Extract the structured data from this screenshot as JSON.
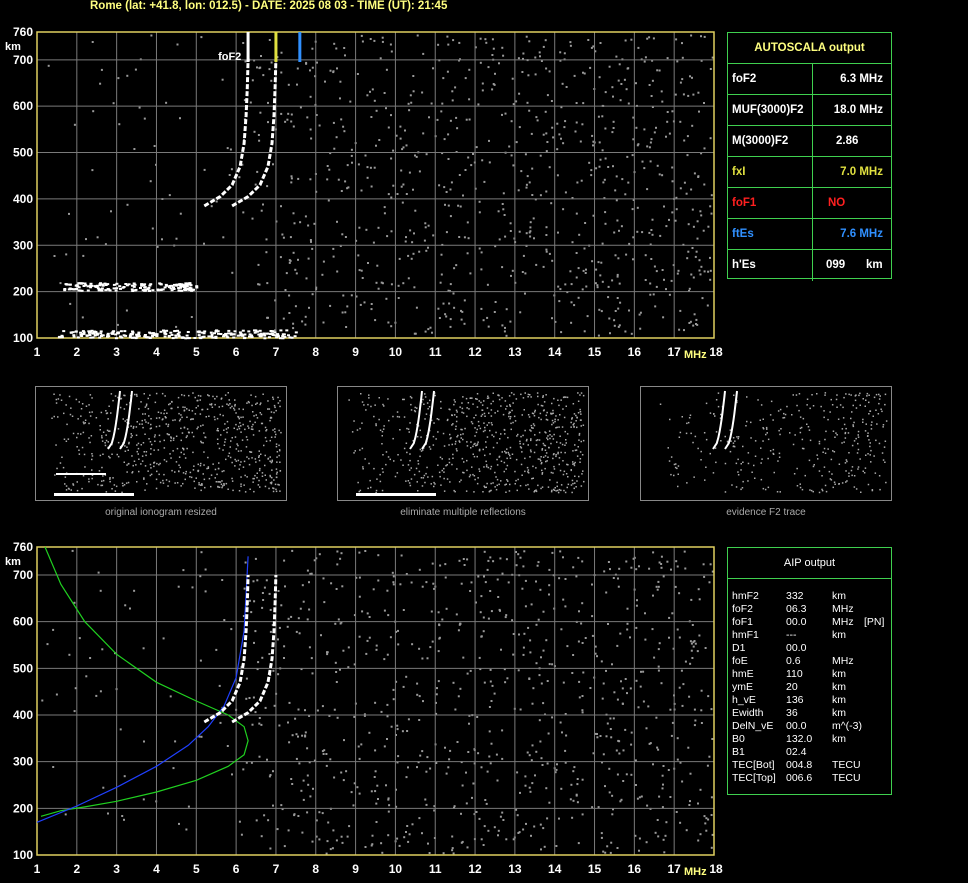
{
  "header": "Rome (lat: +41.8, lon: 012.5) - DATE: 2025 08 03 - TIME (UT): 21:45",
  "autoscala": {
    "title": "AUTOSCALA output",
    "rows": [
      {
        "label": "foF2",
        "value": "6.3 MHz",
        "color": "#ffffff"
      },
      {
        "label": "MUF(3000)F2",
        "value": "18.0 MHz",
        "color": "#ffffff"
      },
      {
        "label": "M(3000)F2",
        "value": "2.86",
        "color": "#ffffff"
      },
      {
        "label": "fxI",
        "value": "7.0 MHz",
        "color": "#e0e040"
      },
      {
        "label": "foF1",
        "value": "NO",
        "color": "#ff2020"
      },
      {
        "label": "ftEs",
        "value": "7.6 MHz",
        "color": "#3090ff"
      },
      {
        "label": "h'Es",
        "value": "099",
        "unit": "km",
        "color": "#ffffff"
      }
    ]
  },
  "aip": {
    "title": "AIP output",
    "rows": [
      {
        "label": "hmF2",
        "value": "332",
        "unit": "km",
        "extra": ""
      },
      {
        "label": "foF2",
        "value": "06.3",
        "unit": "MHz",
        "extra": ""
      },
      {
        "label": "foF1",
        "value": "00.0",
        "unit": "MHz",
        "extra": "[PN]"
      },
      {
        "label": "hmF1",
        "value": "---",
        "unit": "km",
        "extra": ""
      },
      {
        "label": "D1",
        "value": "00.0",
        "unit": "",
        "extra": ""
      },
      {
        "label": "foE",
        "value": "0.6",
        "unit": "MHz",
        "extra": ""
      },
      {
        "label": "hmE",
        "value": "110",
        "unit": "km",
        "extra": ""
      },
      {
        "label": "ymE",
        "value": "20",
        "unit": "km",
        "extra": ""
      },
      {
        "label": "h_vE",
        "value": "136",
        "unit": "km",
        "extra": ""
      },
      {
        "label": "Ewidth",
        "value": "36",
        "unit": "km",
        "extra": ""
      },
      {
        "label": "DelN_vE",
        "value": "00.0",
        "unit": "m^(-3)",
        "extra": ""
      },
      {
        "label": "B0",
        "value": "132.0",
        "unit": "km",
        "extra": ""
      },
      {
        "label": "B1",
        "value": "02.4",
        "unit": "",
        "extra": ""
      },
      {
        "label": "TEC[Bot]",
        "value": "004.8",
        "unit": "TECU",
        "extra": ""
      },
      {
        "label": "TEC[Top]",
        "value": "006.6",
        "unit": "TECU",
        "extra": ""
      }
    ]
  },
  "thumbnails": [
    {
      "label": "original ionogram resized"
    },
    {
      "label": "eliminate multiple reflections"
    },
    {
      "label": "evidence F2 trace"
    }
  ],
  "chart_data": [
    {
      "type": "scatter",
      "xlabel": "MHz",
      "ylabel": "km",
      "xlim": [
        1,
        18
      ],
      "ylim": [
        100,
        760
      ],
      "x_ticks": [
        1,
        2,
        3,
        4,
        5,
        6,
        7,
        8,
        9,
        10,
        11,
        12,
        13,
        14,
        15,
        16,
        17,
        18
      ],
      "y_ticks": [
        100,
        200,
        300,
        400,
        500,
        600,
        700,
        760
      ],
      "markers": [
        {
          "name": "foF2",
          "x": 6.3,
          "color": "#ffffff"
        },
        {
          "name": "fxI",
          "x": 7.0,
          "color": "#e0e040"
        },
        {
          "name": "ftEs",
          "x": 7.6,
          "color": "#3090ff"
        }
      ],
      "series": [
        {
          "name": "o-trace",
          "x": [
            5.2,
            5.6,
            5.9,
            6.1,
            6.2,
            6.25,
            6.28,
            6.3
          ],
          "y": [
            385,
            405,
            430,
            470,
            520,
            580,
            640,
            700
          ]
        },
        {
          "name": "x-trace",
          "x": [
            5.9,
            6.3,
            6.6,
            6.8,
            6.9,
            6.95,
            6.98,
            7.0
          ],
          "y": [
            385,
            405,
            430,
            470,
            520,
            580,
            640,
            700
          ]
        },
        {
          "name": "Es",
          "x": [
            1.5,
            2.5,
            3.5,
            4.5,
            5.5,
            6.5,
            7.5
          ],
          "y": [
            110,
            110,
            110,
            110,
            110,
            110,
            110
          ]
        },
        {
          "name": "Es-multiple",
          "x": [
            1.5,
            2.5,
            3.5,
            4.5,
            5.0
          ],
          "y": [
            212,
            212,
            212,
            212,
            212
          ]
        }
      ]
    },
    {
      "type": "line",
      "xlabel": "MHz",
      "ylabel": "km",
      "xlim": [
        1,
        18
      ],
      "ylim": [
        100,
        760
      ],
      "x_ticks": [
        1,
        2,
        3,
        4,
        5,
        6,
        7,
        8,
        9,
        10,
        11,
        12,
        13,
        14,
        15,
        16,
        17,
        18
      ],
      "y_ticks": [
        100,
        200,
        300,
        400,
        500,
        600,
        700,
        760
      ],
      "series": [
        {
          "name": "profile",
          "color": "#20d020",
          "x": [
            1.1,
            1.6,
            2.2,
            3.0,
            4.0,
            5.0,
            5.8,
            6.2,
            6.3,
            6.2,
            5.8,
            5.0,
            4.0,
            3.0,
            2.2,
            1.6,
            1.2
          ],
          "y": [
            183,
            195,
            203,
            215,
            235,
            260,
            290,
            315,
            345,
            375,
            400,
            430,
            470,
            530,
            600,
            680,
            760
          ]
        },
        {
          "name": "virtual",
          "color": "#2040ff",
          "x": [
            1.0,
            2.0,
            3.0,
            4.0,
            4.8,
            5.3,
            5.7,
            6.0,
            6.2,
            6.3
          ],
          "y": [
            170,
            205,
            245,
            290,
            335,
            375,
            420,
            480,
            580,
            740
          ]
        },
        {
          "name": "o-trace",
          "color": "#ffffff",
          "x": [
            5.2,
            5.6,
            5.9,
            6.1,
            6.2,
            6.25,
            6.28,
            6.3
          ],
          "y": [
            385,
            405,
            430,
            470,
            520,
            580,
            640,
            700
          ]
        },
        {
          "name": "x-trace",
          "color": "#ffffff",
          "x": [
            5.9,
            6.3,
            6.6,
            6.8,
            6.9,
            6.95,
            6.98,
            7.0
          ],
          "y": [
            385,
            405,
            430,
            470,
            520,
            580,
            640,
            700
          ]
        }
      ]
    }
  ]
}
